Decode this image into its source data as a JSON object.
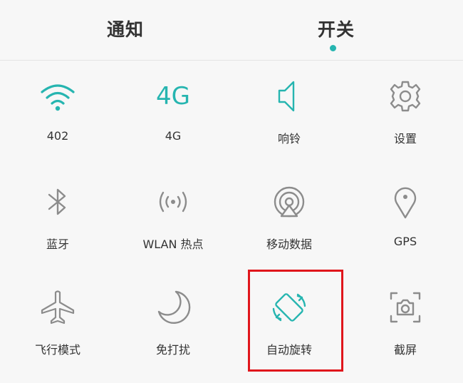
{
  "colors": {
    "accent": "#26b5b0",
    "icon_gray": "#8c8c8c",
    "highlight": "#e0161c",
    "text": "#333333",
    "background": "#f7f7f7"
  },
  "tabs": {
    "notify": "通知",
    "switch": "开关",
    "active": "switch"
  },
  "tiles": [
    {
      "label": "402",
      "icon": "wifi-icon",
      "active": true
    },
    {
      "label": "4G",
      "icon": "4g-icon",
      "icon_text": "4G",
      "active": true
    },
    {
      "label": "响铃",
      "icon": "ringer-speaker-icon",
      "active": true
    },
    {
      "label": "设置",
      "icon": "gear-icon",
      "active": false
    },
    {
      "label": "蓝牙",
      "icon": "bluetooth-icon",
      "active": false
    },
    {
      "label": "WLAN 热点",
      "icon": "hotspot-icon",
      "active": false
    },
    {
      "label": "移动数据",
      "icon": "mobile-data-icon",
      "active": false
    },
    {
      "label": "GPS",
      "icon": "location-pin-icon",
      "active": false
    },
    {
      "label": "飞行模式",
      "icon": "airplane-icon",
      "active": false
    },
    {
      "label": "免打扰",
      "icon": "moon-icon",
      "active": false
    },
    {
      "label": "自动旋转",
      "icon": "auto-rotate-icon",
      "active": true,
      "highlighted": true
    },
    {
      "label": "截屏",
      "icon": "screenshot-camera-icon",
      "active": false
    }
  ]
}
